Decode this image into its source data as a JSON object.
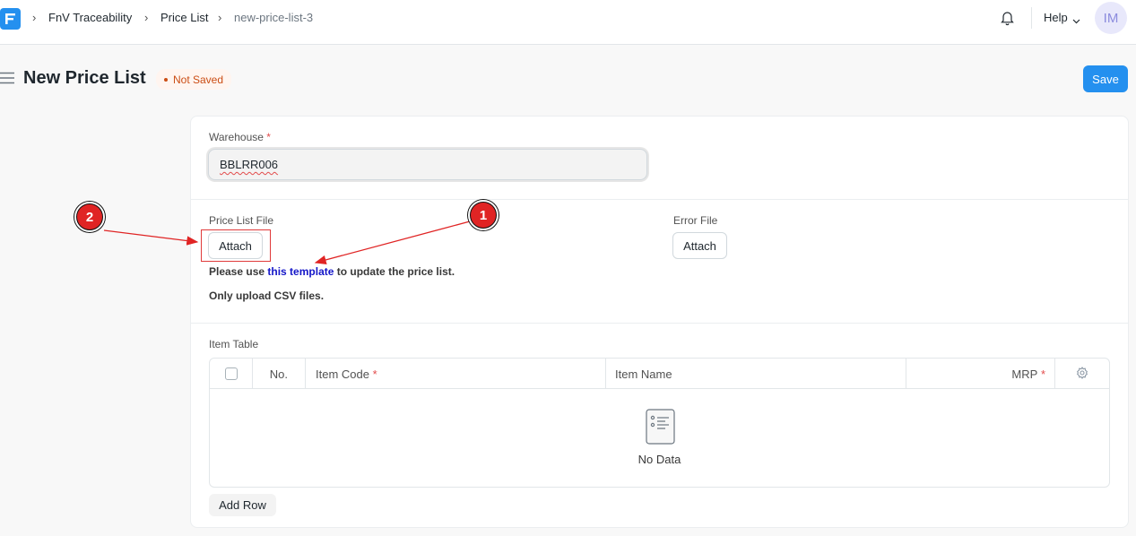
{
  "breadcrumbs": [
    "FnV Traceability",
    "Price List",
    "new-price-list-3"
  ],
  "navbar": {
    "help_label": "Help",
    "avatar_initials": "IM"
  },
  "page": {
    "title": "New Price List",
    "status": "Not Saved",
    "save_label": "Save"
  },
  "form": {
    "warehouse_label": "Warehouse",
    "warehouse_value": "BBLRR006",
    "required_mark": "*",
    "price_list_file_label": "Price List File",
    "error_file_label": "Error File",
    "attach_label": "Attach",
    "help_prefix": "Please use ",
    "help_link": "this template",
    "help_suffix": " to update the price list.",
    "csv_note": "Only upload CSV files."
  },
  "item_table": {
    "label": "Item Table",
    "columns": [
      "No.",
      "Item Code",
      "Item Name",
      "MRP"
    ],
    "empty_text": "No Data",
    "add_row_label": "Add Row"
  },
  "annotations": {
    "marker_1": "1",
    "marker_2": "2",
    "color": "#e02424"
  },
  "colors": {
    "accent": "#2490ef",
    "status": "#cb4d14"
  }
}
